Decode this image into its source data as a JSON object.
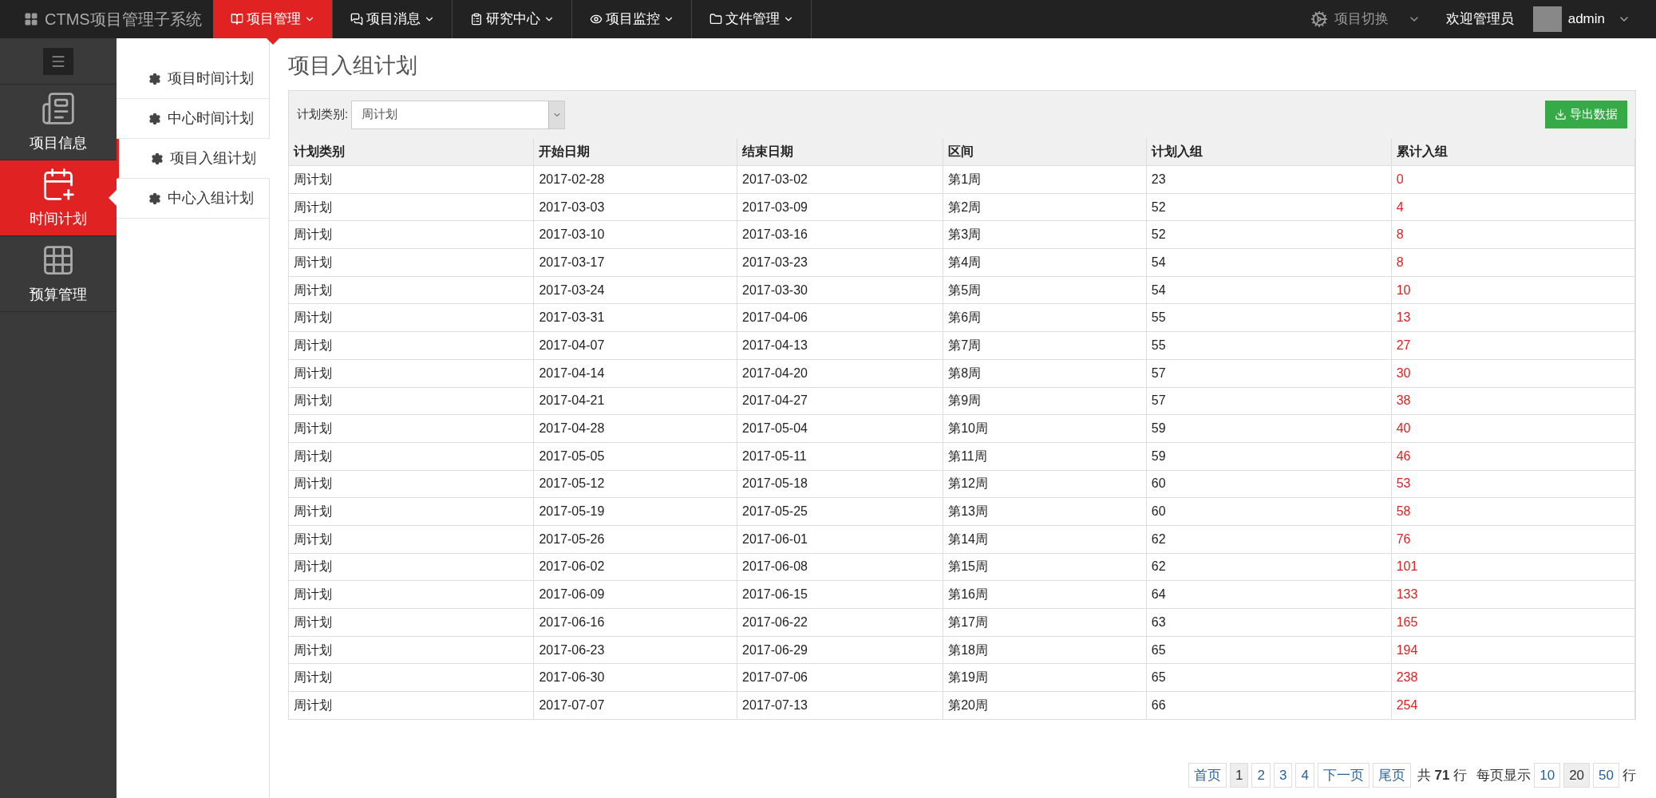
{
  "nav": {
    "brand": "CTMS项目管理子系统",
    "menus": [
      {
        "label": "项目管理",
        "selected": true
      },
      {
        "label": "项目消息",
        "selected": false
      },
      {
        "label": "研究中心",
        "selected": false
      },
      {
        "label": "项目监控",
        "selected": false
      },
      {
        "label": "文件管理",
        "selected": false
      }
    ],
    "project_switch": "项目切换",
    "welcome": "欢迎管理员",
    "user": "admin"
  },
  "sidebar": {
    "items": [
      {
        "label": "项目信息",
        "selected": false
      },
      {
        "label": "时间计划",
        "selected": true
      },
      {
        "label": "预算管理",
        "selected": false
      }
    ]
  },
  "submenu": {
    "items": [
      {
        "label": "项目时间计划",
        "selected": false
      },
      {
        "label": "中心时间计划",
        "selected": false
      },
      {
        "label": "项目入组计划",
        "selected": true
      },
      {
        "label": "中心入组计划",
        "selected": false
      }
    ]
  },
  "page_title": "项目入组计划",
  "filter": {
    "label": "计划类别:",
    "value": "周计划"
  },
  "export_button": "导出数据",
  "table": {
    "columns": [
      {
        "label": "计划类别",
        "kind": "text"
      },
      {
        "label": "开始日期",
        "kind": "text"
      },
      {
        "label": "结束日期",
        "kind": "text"
      },
      {
        "label": "区间",
        "kind": "text"
      },
      {
        "label": "计划入组",
        "kind": "text"
      },
      {
        "label": "累计入组",
        "kind": "highlight"
      }
    ],
    "rows": [
      [
        "周计划",
        "2017-02-28",
        "2017-03-02",
        "第1周",
        "23",
        "0"
      ],
      [
        "周计划",
        "2017-03-03",
        "2017-03-09",
        "第2周",
        "52",
        "4"
      ],
      [
        "周计划",
        "2017-03-10",
        "2017-03-16",
        "第3周",
        "52",
        "8"
      ],
      [
        "周计划",
        "2017-03-17",
        "2017-03-23",
        "第4周",
        "54",
        "8"
      ],
      [
        "周计划",
        "2017-03-24",
        "2017-03-30",
        "第5周",
        "54",
        "10"
      ],
      [
        "周计划",
        "2017-03-31",
        "2017-04-06",
        "第6周",
        "55",
        "13"
      ],
      [
        "周计划",
        "2017-04-07",
        "2017-04-13",
        "第7周",
        "55",
        "27"
      ],
      [
        "周计划",
        "2017-04-14",
        "2017-04-20",
        "第8周",
        "57",
        "30"
      ],
      [
        "周计划",
        "2017-04-21",
        "2017-04-27",
        "第9周",
        "57",
        "38"
      ],
      [
        "周计划",
        "2017-04-28",
        "2017-05-04",
        "第10周",
        "59",
        "40"
      ],
      [
        "周计划",
        "2017-05-05",
        "2017-05-11",
        "第11周",
        "59",
        "46"
      ],
      [
        "周计划",
        "2017-05-12",
        "2017-05-18",
        "第12周",
        "60",
        "53"
      ],
      [
        "周计划",
        "2017-05-19",
        "2017-05-25",
        "第13周",
        "60",
        "58"
      ],
      [
        "周计划",
        "2017-05-26",
        "2017-06-01",
        "第14周",
        "62",
        "76"
      ],
      [
        "周计划",
        "2017-06-02",
        "2017-06-08",
        "第15周",
        "62",
        "101"
      ],
      [
        "周计划",
        "2017-06-09",
        "2017-06-15",
        "第16周",
        "64",
        "133"
      ],
      [
        "周计划",
        "2017-06-16",
        "2017-06-22",
        "第17周",
        "63",
        "165"
      ],
      [
        "周计划",
        "2017-06-23",
        "2017-06-29",
        "第18周",
        "65",
        "194"
      ],
      [
        "周计划",
        "2017-06-30",
        "2017-07-06",
        "第19周",
        "65",
        "238"
      ],
      [
        "周计划",
        "2017-07-07",
        "2017-07-13",
        "第20周",
        "66",
        "254"
      ]
    ]
  },
  "pagination": {
    "pages": [
      {
        "label": "首页",
        "selected": false
      },
      {
        "label": "1",
        "selected": true
      },
      {
        "label": "2",
        "selected": false
      },
      {
        "label": "3",
        "selected": false
      },
      {
        "label": "4",
        "selected": false
      },
      {
        "label": "下一页",
        "selected": false
      },
      {
        "label": "尾页",
        "selected": false
      }
    ],
    "total": "共 **71** 行",
    "per_page_label": "每页显示",
    "sizes": [
      {
        "label": "10",
        "selected": false
      },
      {
        "label": "20",
        "selected": true
      },
      {
        "label": "50",
        "selected": false
      }
    ],
    "unit": "行"
  }
}
